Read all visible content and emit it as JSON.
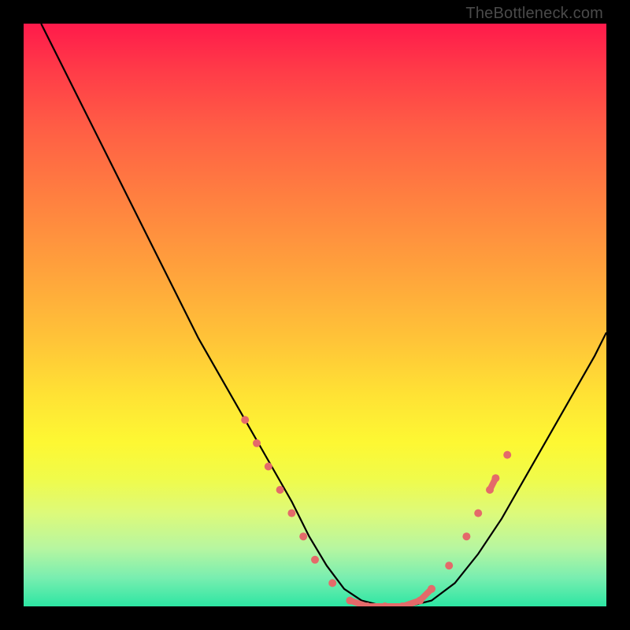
{
  "watermark": "TheBottleneck.com",
  "colors": {
    "frame": "#000000",
    "curve": "#000000",
    "markers": "#e46a6a",
    "gradient_top": "#ff1a4b",
    "gradient_bottom": "#2de6a3"
  },
  "chart_data": {
    "type": "line",
    "title": "",
    "xlabel": "",
    "ylabel": "",
    "xlim": [
      0,
      100
    ],
    "ylim": [
      0,
      100
    ],
    "grid": false,
    "legend": false,
    "note": "Bottleneck curve. Y is bottleneck % (0 at bottom = no bottleneck, 100 at top). X is relative component balance (arbitrary 0-100).",
    "series": [
      {
        "name": "bottleneck-curve",
        "x": [
          3,
          6,
          10,
          14,
          18,
          22,
          26,
          30,
          34,
          38,
          42,
          46,
          49,
          52,
          55,
          58,
          62,
          66,
          70,
          74,
          78,
          82,
          86,
          90,
          94,
          98,
          100
        ],
        "y": [
          100,
          94,
          86,
          78,
          70,
          62,
          54,
          46,
          39,
          32,
          25,
          18,
          12,
          7,
          3,
          1,
          0,
          0,
          1,
          4,
          9,
          15,
          22,
          29,
          36,
          43,
          47
        ]
      }
    ],
    "markers": {
      "name": "highlighted-points",
      "note": "Salmon dots/segments near the valley on both arms of the curve.",
      "points": [
        {
          "x": 38,
          "y": 32
        },
        {
          "x": 40,
          "y": 28
        },
        {
          "x": 42,
          "y": 24
        },
        {
          "x": 44,
          "y": 20
        },
        {
          "x": 46,
          "y": 16
        },
        {
          "x": 48,
          "y": 12
        },
        {
          "x": 50,
          "y": 8
        },
        {
          "x": 53,
          "y": 4
        },
        {
          "x": 56,
          "y": 1
        },
        {
          "x": 59,
          "y": 0
        },
        {
          "x": 62,
          "y": 0
        },
        {
          "x": 65,
          "y": 0
        },
        {
          "x": 68,
          "y": 1
        },
        {
          "x": 70,
          "y": 3
        },
        {
          "x": 73,
          "y": 7
        },
        {
          "x": 76,
          "y": 12
        },
        {
          "x": 78,
          "y": 16
        },
        {
          "x": 80,
          "y": 20
        },
        {
          "x": 81,
          "y": 22
        },
        {
          "x": 83,
          "y": 26
        }
      ]
    }
  }
}
